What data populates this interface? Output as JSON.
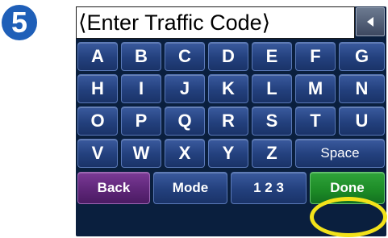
{
  "step_badge": "5",
  "input": {
    "value": "⟨Enter Traffic Code⟩"
  },
  "backspace": {
    "icon": "triangle-left-icon"
  },
  "keys": {
    "row1": [
      "A",
      "B",
      "C",
      "D",
      "E",
      "F",
      "G"
    ],
    "row2": [
      "H",
      "I",
      "J",
      "K",
      "L",
      "M",
      "N"
    ],
    "row3": [
      "O",
      "P",
      "Q",
      "R",
      "S",
      "T",
      "U"
    ],
    "row4": [
      "V",
      "W",
      "X",
      "Y",
      "Z"
    ],
    "space": "Space",
    "back": "Back",
    "mode": "Mode",
    "numbers": "1 2 3",
    "done": "Done"
  },
  "colors": {
    "key_blue": "#23407d",
    "back_purple": "#5c2576",
    "done_green": "#1c8a26",
    "highlight_yellow": "#f2e21a",
    "badge_blue": "#1f5fb8"
  }
}
